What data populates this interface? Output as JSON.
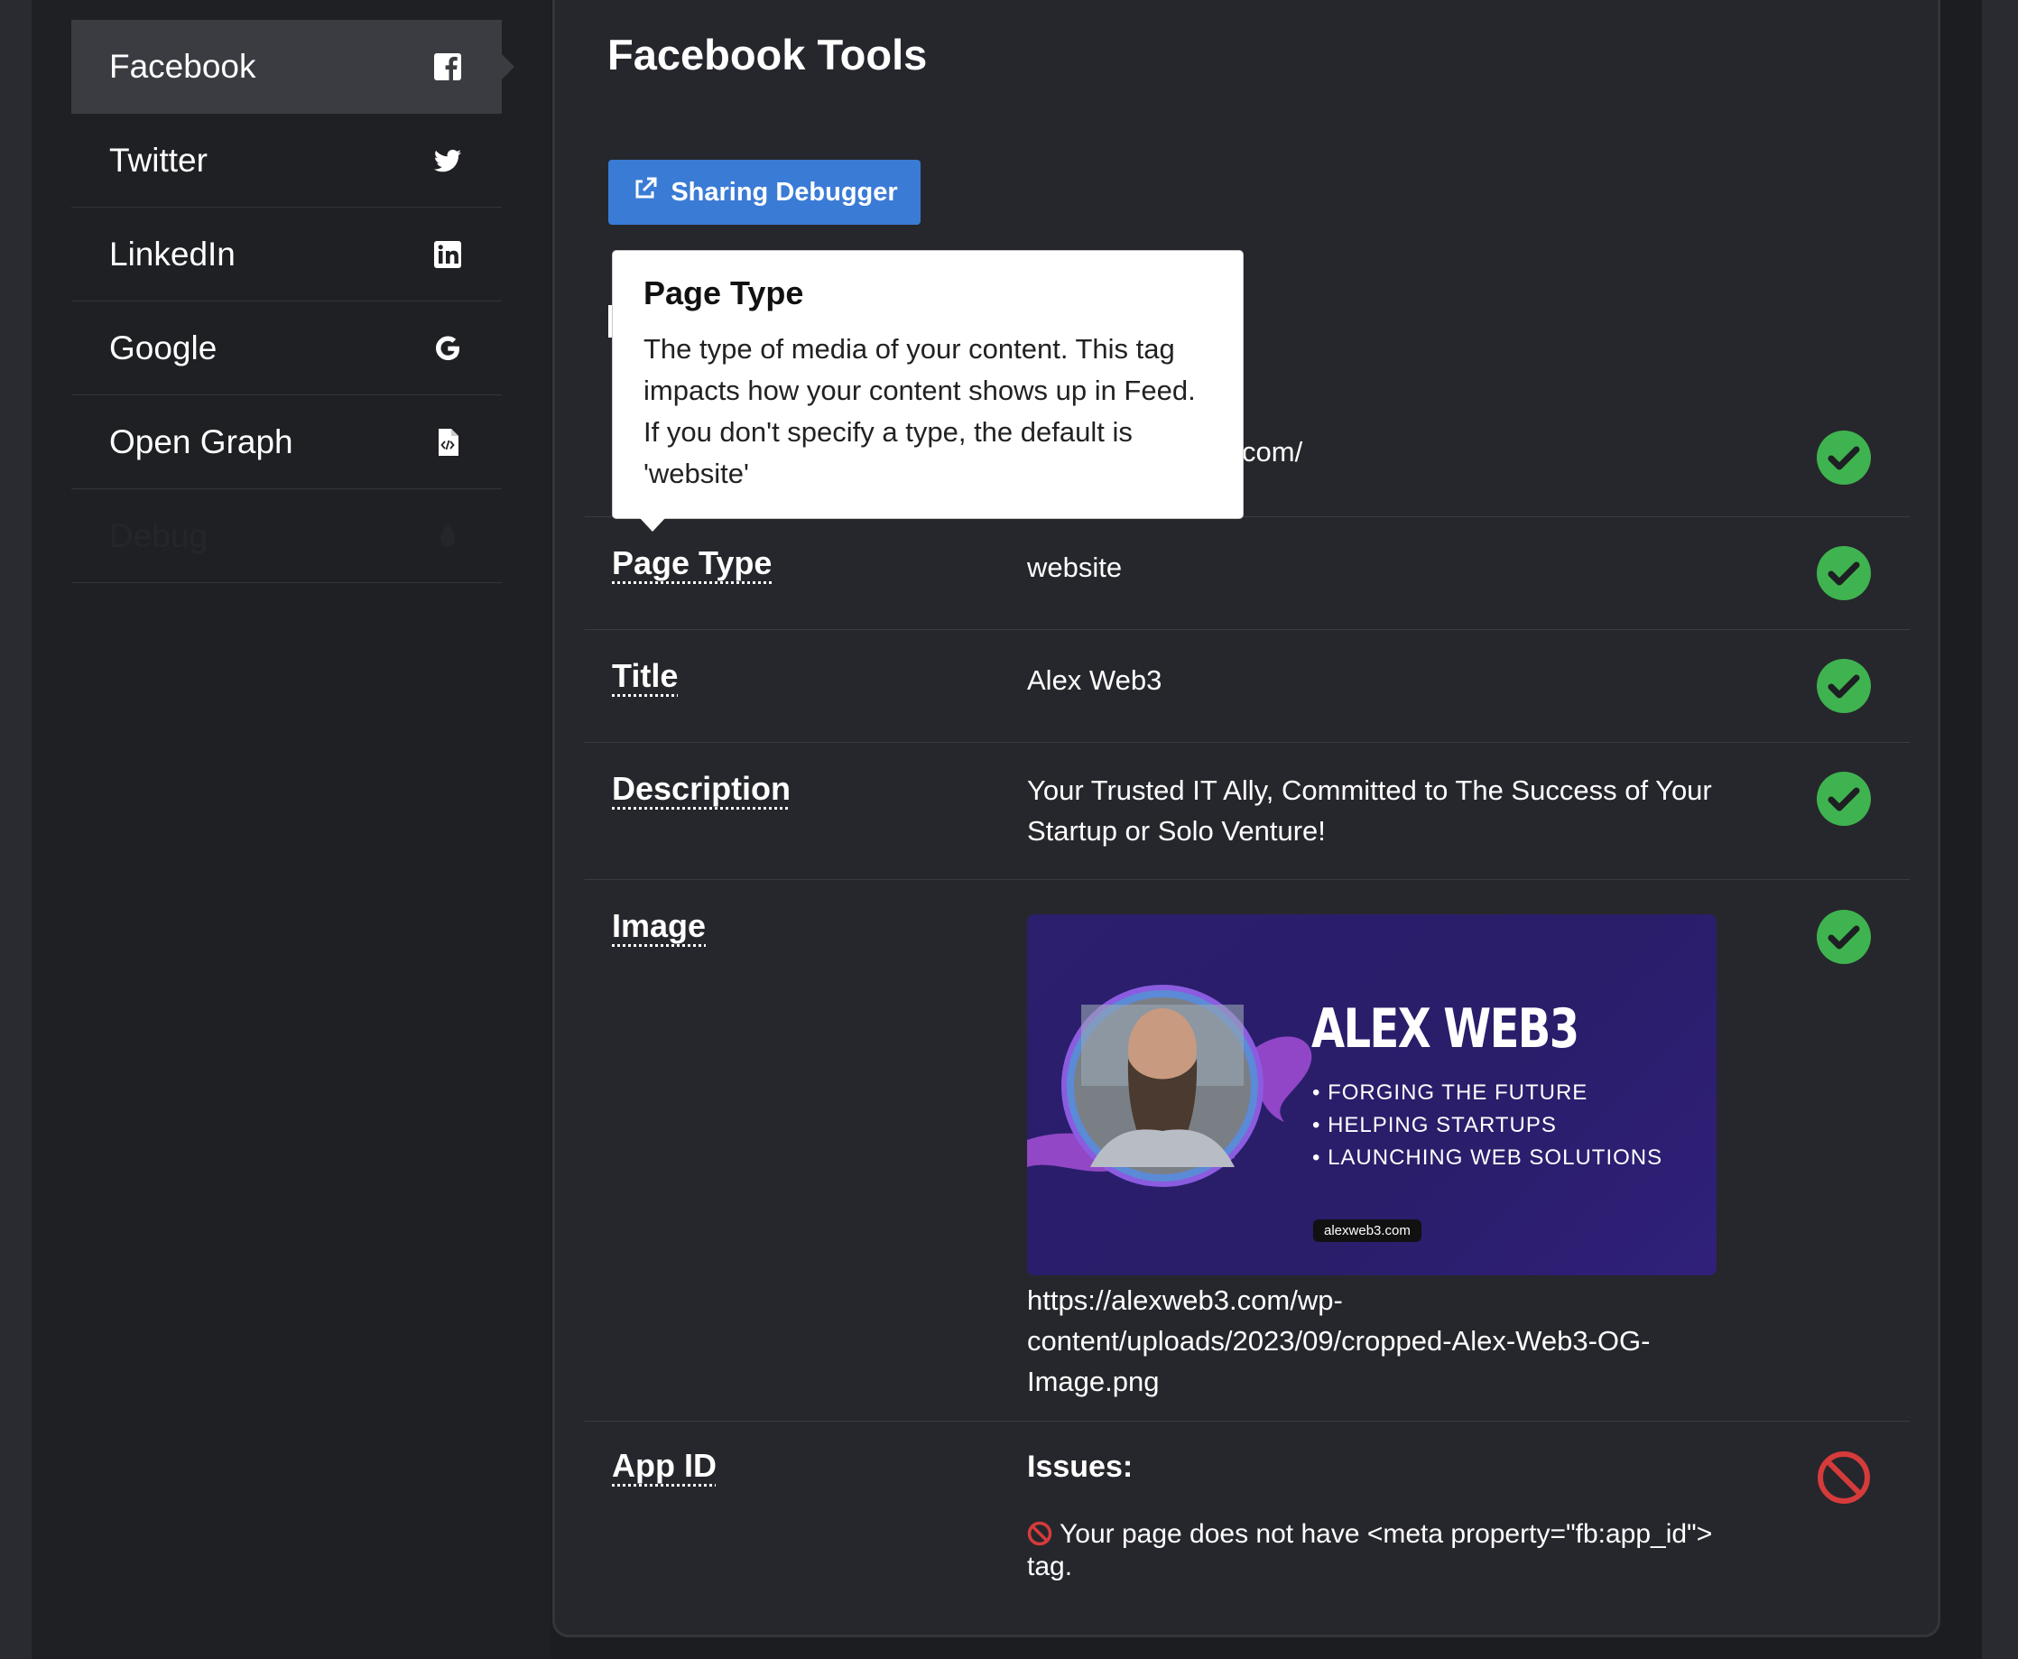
{
  "sidebar": {
    "items": [
      {
        "label": "Facebook",
        "icon": "facebook-square-icon"
      },
      {
        "label": "Twitter",
        "icon": "twitter-bird-icon"
      },
      {
        "label": "LinkedIn",
        "icon": "linkedin-icon"
      },
      {
        "label": "Google",
        "icon": "google-g-icon"
      },
      {
        "label": "Open Graph",
        "icon": "code-file-icon"
      },
      {
        "label": "Debug",
        "icon": "bug-icon"
      }
    ]
  },
  "main": {
    "title": "Facebook Tools",
    "debugger_button": "Sharing Debugger",
    "url_fragment": "com/",
    "rows": {
      "page_type": {
        "label": "Page Type",
        "value": "website"
      },
      "title": {
        "label": "Title",
        "value": "Alex Web3"
      },
      "description": {
        "label": "Description",
        "value": "Your Trusted IT Ally, Committed to The Success of Your Startup or Solo Venture!"
      },
      "image": {
        "label": "Image",
        "url": "https://alexweb3.com/wp-content/uploads/2023/09/cropped-Alex-Web3-OG-Image.png",
        "preview": {
          "heading": "ALEX WEB3",
          "bullets": [
            "• FORGING THE FUTURE",
            "• HELPING STARTUPS",
            "• LAUNCHING WEB SOLUTIONS"
          ],
          "domain": "alexweb3.com"
        }
      },
      "app_id": {
        "label": "App ID",
        "issues_title": "Issues:",
        "issue_text": "Your page does not have <meta property=\"fb:app_id\"> tag."
      }
    }
  },
  "tooltip": {
    "title": "Page Type",
    "body": "The type of media of your content. This tag impacts how your content shows up in Feed. If you don't specify a type, the default is 'website'"
  },
  "colors": {
    "ok": "#3fb34f",
    "error": "#d63b3b",
    "button": "#3a7bd5"
  }
}
